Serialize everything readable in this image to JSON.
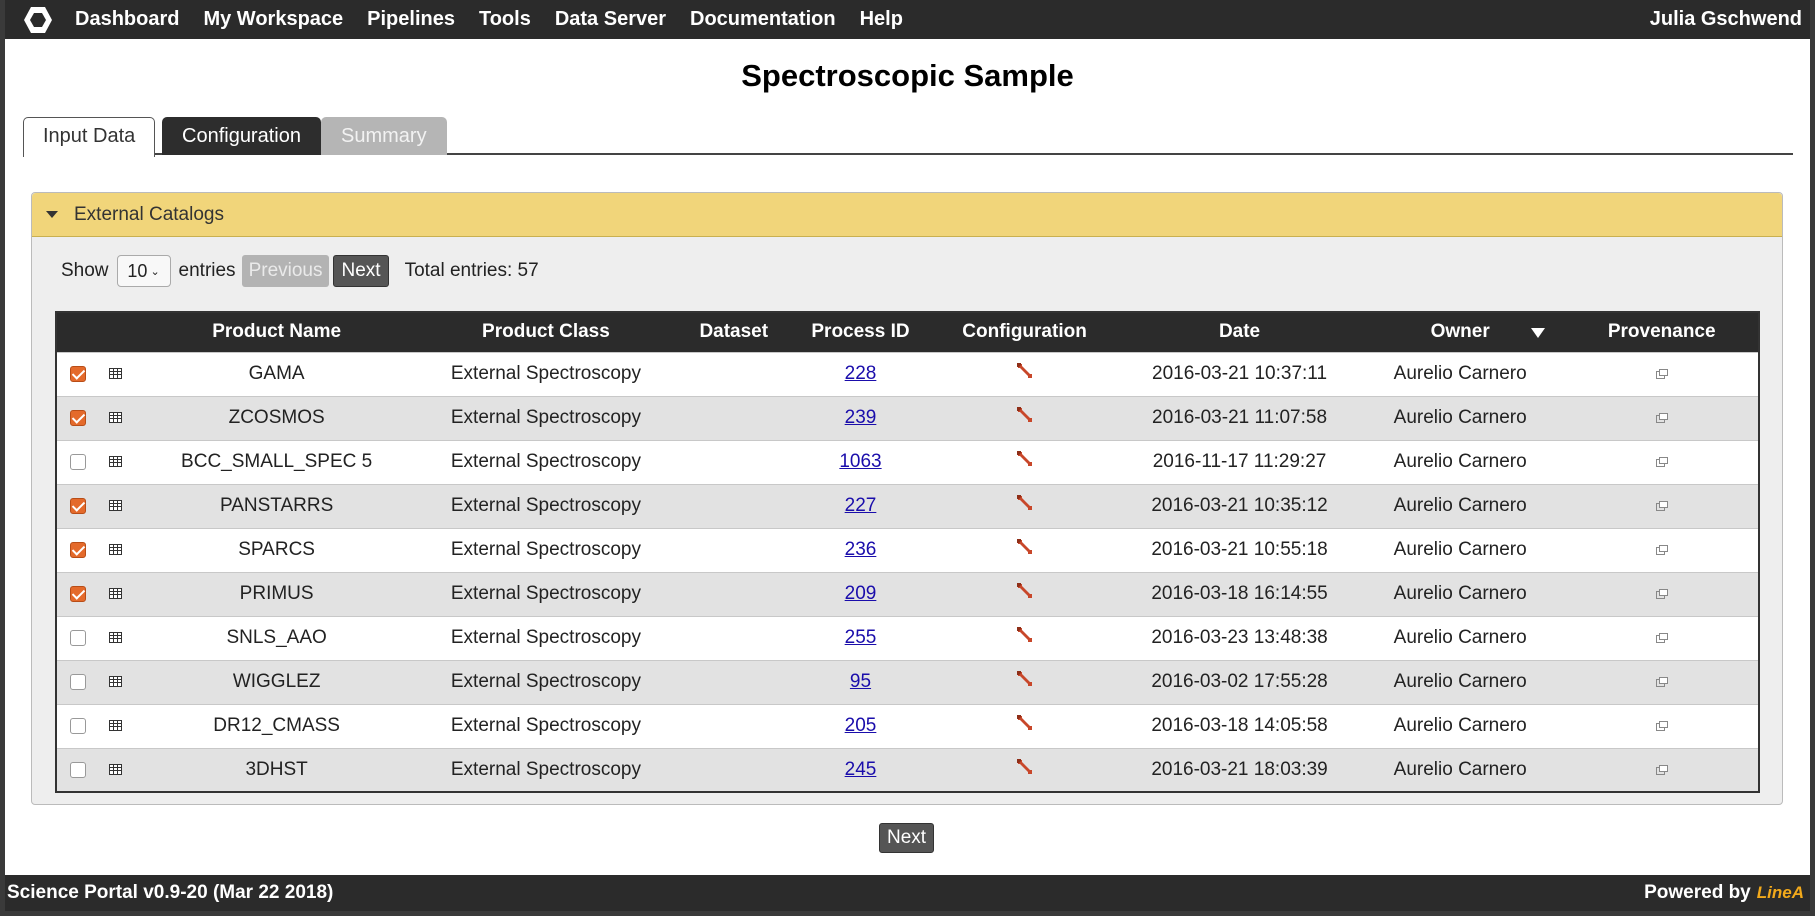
{
  "nav": {
    "items": [
      "Dashboard",
      "My Workspace",
      "Pipelines",
      "Tools",
      "Data Server",
      "Documentation",
      "Help"
    ],
    "user": "Julia Gschwend"
  },
  "page": {
    "title": "Spectroscopic Sample"
  },
  "tabs": [
    {
      "label": "Input Data",
      "state": "active"
    },
    {
      "label": "Configuration",
      "state": "normal"
    },
    {
      "label": "Summary",
      "state": "disabled"
    }
  ],
  "panel": {
    "title": "External Catalogs",
    "show_label": "Show",
    "entries_value": "10",
    "entries_label": "entries",
    "previous_label": "Previous",
    "next_label": "Next",
    "total_label": "Total entries: 57"
  },
  "table": {
    "columns": [
      "Product Name",
      "Product Class",
      "Dataset",
      "Process ID",
      "Configuration",
      "Date",
      "Owner",
      "Provenance"
    ],
    "rows": [
      {
        "checked": true,
        "name": "GAMA",
        "class": "External Spectroscopy",
        "dataset": "",
        "pid": "228",
        "date": "2016-03-21 10:37:11",
        "owner": "Aurelio Carnero"
      },
      {
        "checked": true,
        "name": "ZCOSMOS",
        "class": "External Spectroscopy",
        "dataset": "",
        "pid": "239",
        "date": "2016-03-21 11:07:58",
        "owner": "Aurelio Carnero"
      },
      {
        "checked": false,
        "name": "BCC_SMALL_SPEC 5",
        "class": "External Spectroscopy",
        "dataset": "",
        "pid": "1063",
        "date": "2016-11-17 11:29:27",
        "owner": "Aurelio Carnero"
      },
      {
        "checked": true,
        "name": "PANSTARRS",
        "class": "External Spectroscopy",
        "dataset": "",
        "pid": "227",
        "date": "2016-03-21 10:35:12",
        "owner": "Aurelio Carnero"
      },
      {
        "checked": true,
        "name": "SPARCS",
        "class": "External Spectroscopy",
        "dataset": "",
        "pid": "236",
        "date": "2016-03-21 10:55:18",
        "owner": "Aurelio Carnero"
      },
      {
        "checked": true,
        "name": "PRIMUS",
        "class": "External Spectroscopy",
        "dataset": "",
        "pid": "209",
        "date": "2016-03-18 16:14:55",
        "owner": "Aurelio Carnero"
      },
      {
        "checked": false,
        "name": "SNLS_AAO",
        "class": "External Spectroscopy",
        "dataset": "",
        "pid": "255",
        "date": "2016-03-23 13:48:38",
        "owner": "Aurelio Carnero"
      },
      {
        "checked": false,
        "name": "WIGGLEZ",
        "class": "External Spectroscopy",
        "dataset": "",
        "pid": "95",
        "date": "2016-03-02 17:55:28",
        "owner": "Aurelio Carnero"
      },
      {
        "checked": false,
        "name": "DR12_CMASS",
        "class": "External Spectroscopy",
        "dataset": "",
        "pid": "205",
        "date": "2016-03-18 14:05:58",
        "owner": "Aurelio Carnero"
      },
      {
        "checked": false,
        "name": "3DHST",
        "class": "External Spectroscopy",
        "dataset": "",
        "pid": "245",
        "date": "2016-03-21 18:03:39",
        "owner": "Aurelio Carnero"
      }
    ]
  },
  "bottom": {
    "next_label": "Next"
  },
  "footer": {
    "version": "Science Portal v0.9-20 (Mar 22 2018)",
    "powered_by": "Powered by",
    "brand": "LineA"
  },
  "colors": {
    "accent": "#f1d57a",
    "checkbox": "#e46a2b",
    "dark": "#2b2b2b",
    "link": "#1a0dab"
  },
  "icons": {
    "logo": "hexagon-logo-icon",
    "table_row": "table-icon",
    "configuration": "wrench-icon",
    "provenance": "external-link-icon",
    "sort": "sort-desc-icon",
    "collapse": "caret-down-icon"
  }
}
